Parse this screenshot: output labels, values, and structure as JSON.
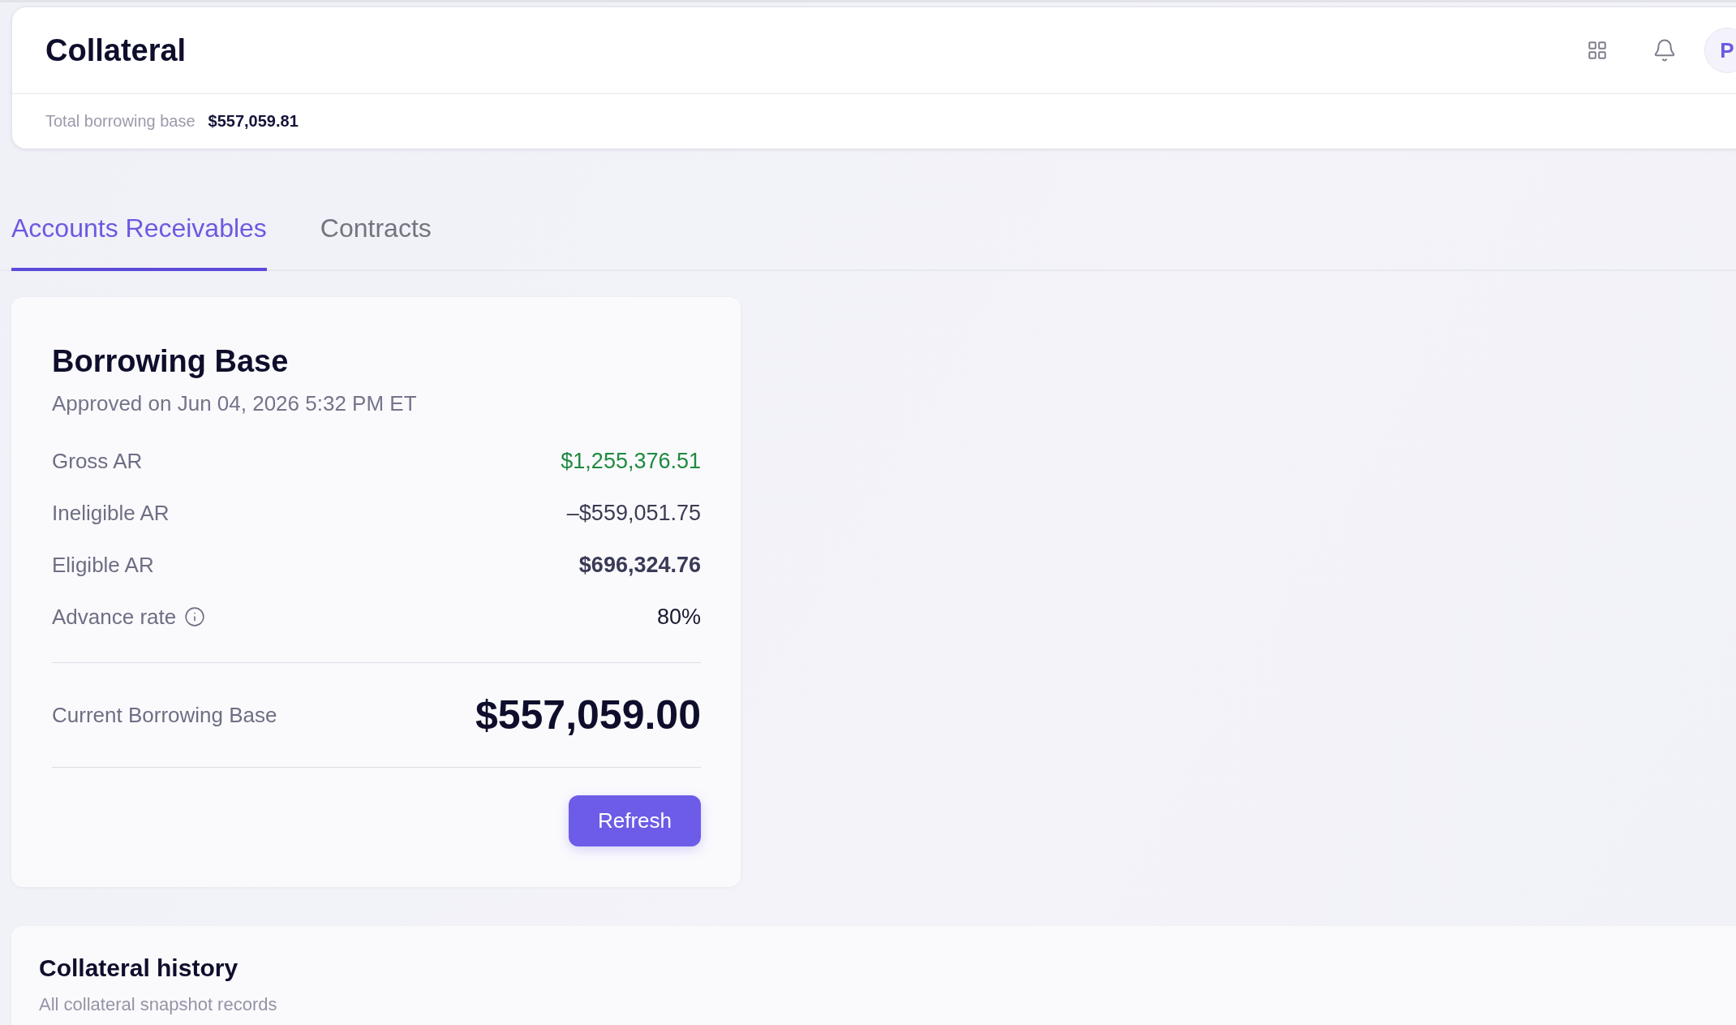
{
  "header": {
    "title": "Collateral",
    "summary_label": "Total borrowing base",
    "summary_value": "$557,059.81",
    "avatar_initial": "P"
  },
  "tabs": [
    {
      "label": "Accounts Receivables",
      "selected": true
    },
    {
      "label": "Contracts",
      "selected": false
    }
  ],
  "borrowing_base": {
    "title": "Borrowing Base",
    "subtitle": "Approved on Jun 04, 2026 5:32 PM ET",
    "rows": [
      {
        "label": "Gross AR",
        "value": "$1,255,376.51",
        "kind": "gain"
      },
      {
        "label": "Ineligible AR",
        "value": "–$559,051.75",
        "kind": "deduction"
      },
      {
        "label": "Eligible AR",
        "value": "$696,324.76",
        "kind": "subtotal"
      },
      {
        "label": "Advance rate",
        "value": "80%",
        "kind": "rate"
      }
    ],
    "total_label": "Current Borrowing Base",
    "total_value": "$557,059.00",
    "button": "Refresh"
  },
  "history": {
    "title": "Collateral history",
    "subtitle": "All collateral snapshot records"
  }
}
